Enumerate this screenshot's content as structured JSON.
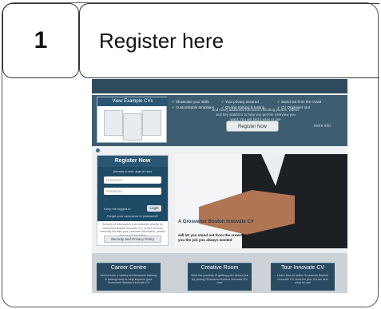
{
  "slide": {
    "step_number": "1",
    "title": "Register here"
  },
  "website": {
    "cv_panel_title": "View Example CVs",
    "features": [
      "Showcase your skills",
      "Your privacy assured",
      "Stand out from the crowd",
      "Customisable templates",
      "On-line training & testing",
      "CV Organiser tool"
    ],
    "hero_note": "and many additional functions including photos, videos and key statistics to help you get the interview you want. You will find it easy to use",
    "hero_button": "Register Now",
    "hero_link": "more info",
    "register": {
      "heading": "Register Now",
      "subheading": "Already a user, sign-in here",
      "username_placeholder": "Username",
      "password_placeholder": "Password",
      "remember_label": "Keep me logged in",
      "login_button": "Login",
      "forgot_link": "Forgot your username or password?",
      "note": "Security of information is an absolute priority for Grosvenor Boston Innovate CV. To find out how seriously we take your personal information, please click on the link below",
      "privacy_button": "Security and Privacy Policy"
    },
    "claim": {
      "title": "A Grosvenor Boston Innovate CV",
      "subtitle": "will let you stand out from the crowd and help get you the job you always wanted"
    },
    "tiles": [
      {
        "heading": "Career Centre",
        "body": "Select from a variety of interactive training & testing tools to help improve your Grosvenor Boston Innovate CV"
      },
      {
        "heading": "Creative Room",
        "body": "Start the process of getting your dream job by joining Grosvenor Boston Innovate CV now"
      },
      {
        "heading": "Tour Innovate CV",
        "body": "Learn how to make Grosvenor Boston Innovate CV work for you. It's fun and easy to use"
      }
    ]
  }
}
